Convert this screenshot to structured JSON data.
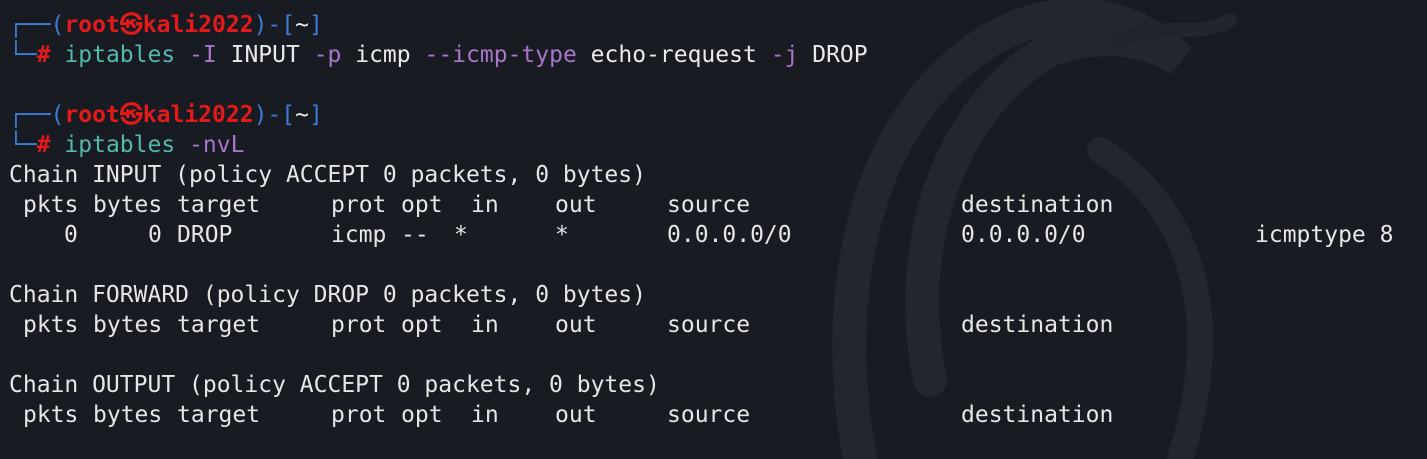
{
  "prompts": [
    {
      "user": "root",
      "sep": "㉿",
      "host": "kali2022",
      "dir": "~",
      "cmd": "iptables",
      "tokens": [
        {
          "t": " "
        },
        {
          "t": "-I",
          "k": "flag"
        },
        {
          "t": " INPUT ",
          "k": "arg"
        },
        {
          "t": "-p",
          "k": "flag"
        },
        {
          "t": " icmp ",
          "k": "arg"
        },
        {
          "t": "--icmp-type",
          "k": "flag"
        },
        {
          "t": " echo-request ",
          "k": "arg"
        },
        {
          "t": "-j",
          "k": "flag"
        },
        {
          "t": " DROP",
          "k": "arg"
        }
      ]
    },
    {
      "user": "root",
      "sep": "㉿",
      "host": "kali2022",
      "dir": "~",
      "cmd": "iptables",
      "tokens": [
        {
          "t": " "
        },
        {
          "t": "-nvL",
          "k": "flag"
        }
      ]
    }
  ],
  "headers": [
    "pkts",
    "bytes",
    "target",
    "prot",
    "opt",
    "in",
    "out",
    "source",
    "destination"
  ],
  "chains": [
    {
      "title": "Chain INPUT (policy ACCEPT 0 packets, 0 bytes)",
      "rows": [
        {
          "pkts": "0",
          "bytes": "0",
          "target": "DROP",
          "prot": "icmp",
          "opt": "--",
          "in": "*",
          "out": "*",
          "source": "0.0.0.0/0",
          "destination": "0.0.0.0/0",
          "extra": "icmptype 8"
        }
      ]
    },
    {
      "title": "Chain FORWARD (policy DROP 0 packets, 0 bytes)",
      "rows": []
    },
    {
      "title": "Chain OUTPUT (policy ACCEPT 0 packets, 0 bytes)",
      "rows": []
    }
  ],
  "colors": {
    "background": "#181b22",
    "prompt_frame": "#3b7bd6",
    "prompt_user": "#e41a1a",
    "command": "#53b9ad",
    "option": "#a876c9"
  }
}
